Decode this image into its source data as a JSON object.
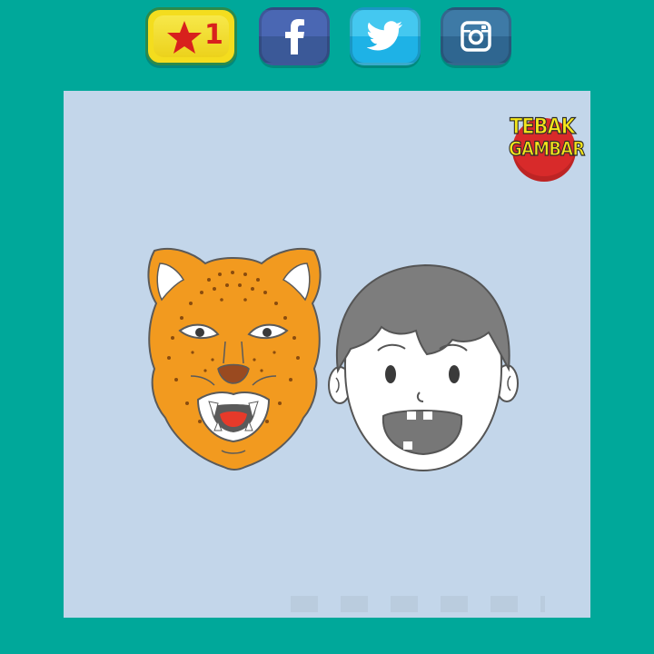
{
  "theme": {
    "background": "#00a89a",
    "panel": "#c3d6ea"
  },
  "toolbar": {
    "star_count": "1",
    "star_icon": "star-icon",
    "social": [
      {
        "name": "facebook",
        "icon": "facebook-icon",
        "color": "#3b5998"
      },
      {
        "name": "twitter",
        "icon": "twitter-icon",
        "color": "#1eb2e6"
      },
      {
        "name": "instagram",
        "icon": "instagram-icon",
        "color": "#2f6690"
      }
    ]
  },
  "logo": {
    "line1": "TEBAK",
    "line2": "GAMBAR"
  },
  "puzzle": {
    "clues": [
      "leopard-face",
      "boy-face-open-mouth"
    ]
  }
}
